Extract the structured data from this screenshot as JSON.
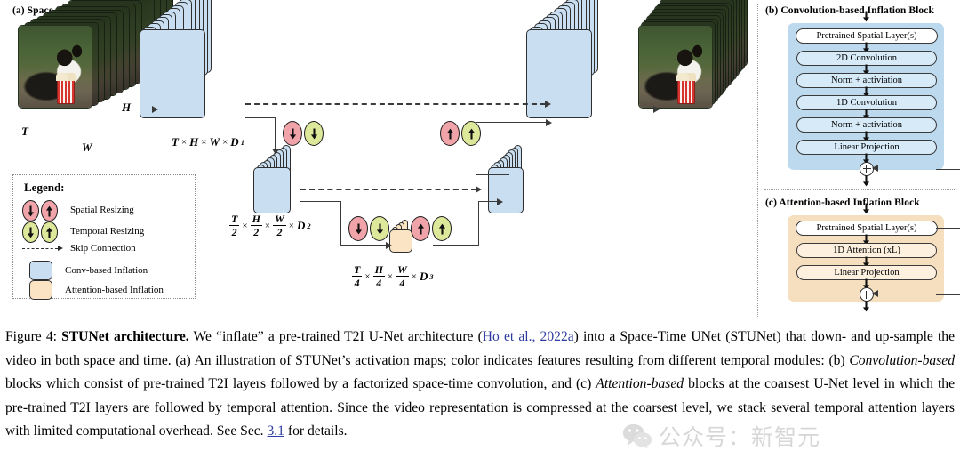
{
  "figure": {
    "panel_a_title": "(a) Space-Time UNet (STUNet)",
    "panel_b_title": "(b) Convolution-based Inflation Block",
    "panel_c_title": "(c) Attention-based Inflation Block"
  },
  "diagram": {
    "axis_labels": {
      "T": "T",
      "H": "H",
      "W": "W"
    },
    "dim_labels": [
      {
        "id": "level1",
        "text": "T × H × W × D1"
      },
      {
        "id": "level2",
        "text": "T/2 × H/2 × W/2 × D2"
      },
      {
        "id": "level3",
        "text": "T/4 × H/4 × W/4 × D3"
      }
    ],
    "depth_symbols": {
      "d1": "D",
      "d1_sub": "1",
      "d2": "D",
      "d2_sub": "2",
      "d3": "D",
      "d3_sub": "3"
    },
    "denominators": {
      "level2": "2",
      "level3": "4"
    },
    "times": "×"
  },
  "legend": {
    "title": "Legend:",
    "items": [
      {
        "label": "Spatial Resizing",
        "kind": "badges",
        "color": "#f0a3a8"
      },
      {
        "label": "Temporal Resizing",
        "kind": "badges",
        "color": "#dde89a"
      },
      {
        "label": "Skip Connection",
        "kind": "dashed"
      },
      {
        "label": "Conv-based Inflation",
        "kind": "swatch",
        "color": "#c9dff1"
      },
      {
        "label": "Attention-based Inflation",
        "kind": "swatch",
        "color": "#fae4c3"
      }
    ]
  },
  "conv_block": {
    "bg_color": "#bcd9ee",
    "rows": [
      "Pretrained Spatial Layer(s)",
      "2D Convolution",
      "Norm + activiation",
      "1D Convolution",
      "Norm + activiation",
      "Linear Projection"
    ]
  },
  "attn_block": {
    "bg_color": "#f6dfbf",
    "rows": [
      "Pretrained Spatial Layer(s)",
      "1D Attention (xL)",
      "Linear Projection"
    ]
  },
  "caption": {
    "prefix": "Figure 4: ",
    "bold_title": "STUNet architecture.",
    "part1": " We “inflate” a pre-trained T2I U-Net architecture (",
    "citation": "Ho et al., 2022a",
    "part2": ") into a Space-Time UNet (STUNet) that down- and up-sample the video in both space and time. (a) An illustration of STUNet’s activation maps; color indicates features resulting from different temporal modules: (b) ",
    "italic1": "Convolution-based",
    "part3": " blocks which consist of pre-trained T2I layers followed by a factorized space-time convolution, and (c) ",
    "italic2": "Attention-based",
    "part4": " blocks at the coarsest U-Net level in which the pre-trained T2I layers are followed by temporal attention. Since the video representation is compressed at the coarsest level, we stack several temporal attention layers with limited computational overhead. See Sec. ",
    "section_link": "3.1",
    "part5": " for details."
  },
  "watermark": {
    "text": "公众号：新智元"
  },
  "colors": {
    "conv_fill": "#c9dff1",
    "attn_fill": "#fae4c3",
    "spatial_badge": "#f0a3a8",
    "temporal_badge": "#dde89a",
    "link": "#2d3c9e",
    "stroke": "#2e2e2e"
  }
}
